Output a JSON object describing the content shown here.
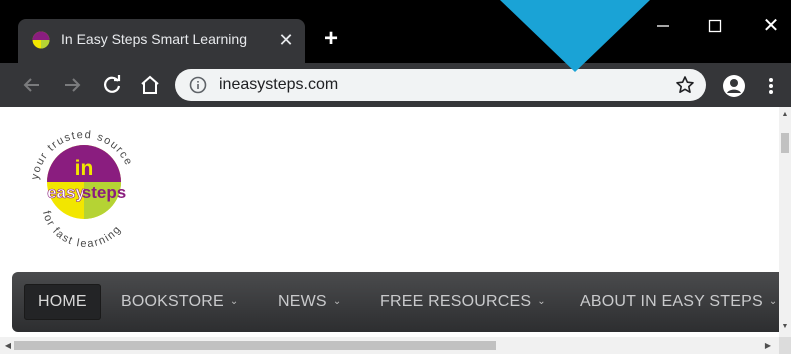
{
  "browser": {
    "tab": {
      "title": "In Easy Steps Smart Learning",
      "favicon": "ineasysteps-favicon",
      "close_glyph": "✕"
    },
    "new_tab_glyph": "+",
    "window_controls": {
      "close_glyph": "✕"
    },
    "toolbar": {
      "url": "ineasysteps.com",
      "icons": [
        "back-arrow-icon",
        "forward-arrow-icon",
        "reload-icon",
        "home-icon",
        "info-icon",
        "star-icon",
        "profile-icon",
        "menu-icon"
      ]
    },
    "colors": {
      "titlebar": "#000000",
      "toolbar": "#353639",
      "omnibox": "#f1f3f4",
      "callout": "#1aa3d6"
    }
  },
  "page": {
    "logo": {
      "ring_text_top": "your trusted source",
      "ring_text_bottom": "for fast learning",
      "word_in": "in",
      "word_easy": "easy",
      "word_steps": "steps",
      "colors": {
        "purple": "#8a1d7f",
        "lime": "#b5d334",
        "yellow": "#f2e600"
      }
    },
    "nav": {
      "items": [
        {
          "label": "HOME",
          "dropdown": false,
          "active": true
        },
        {
          "label": "BOOKSTORE",
          "dropdown": true
        },
        {
          "label": "NEWS",
          "dropdown": true
        },
        {
          "label": "FREE RESOURCES",
          "dropdown": true
        },
        {
          "label": "ABOUT IN EASY STEPS",
          "dropdown": true
        }
      ],
      "caret_glyph": "⌄"
    }
  }
}
